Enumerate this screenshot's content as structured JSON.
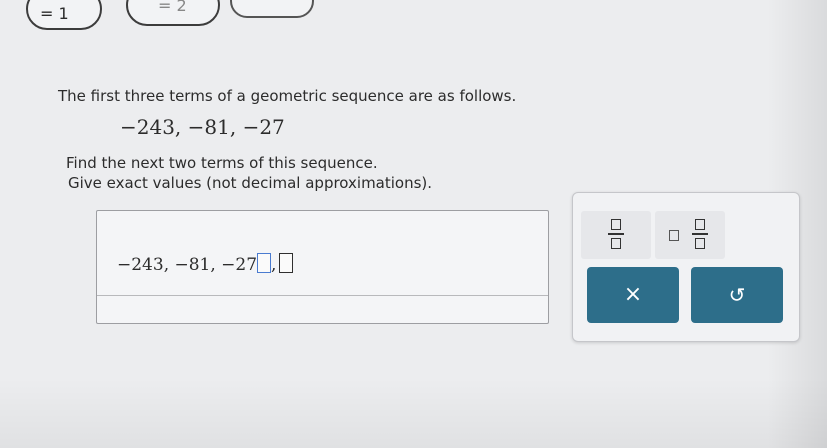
{
  "top_choices": [
    {
      "label": "= 1"
    },
    {
      "label": "= 2"
    },
    {
      "label": ""
    }
  ],
  "question": {
    "intro": "The first three terms of a geometric sequence are as follows.",
    "sequence": "−243, −81, −27",
    "instruction1": "Find the next two terms of this sequence.",
    "instruction2": "Give exact values (not decimal approximations)."
  },
  "answer": {
    "prefix": "−243, −81, −27,",
    "separator": ","
  },
  "keypad": {
    "clear_label": "×",
    "undo_label": "↺",
    "fraction_tool": "fraction-icon",
    "mixed_number_tool": "mixed-number-icon"
  },
  "colors": {
    "button": "#2d6e8a",
    "active_blank": "#4a7bd0"
  }
}
